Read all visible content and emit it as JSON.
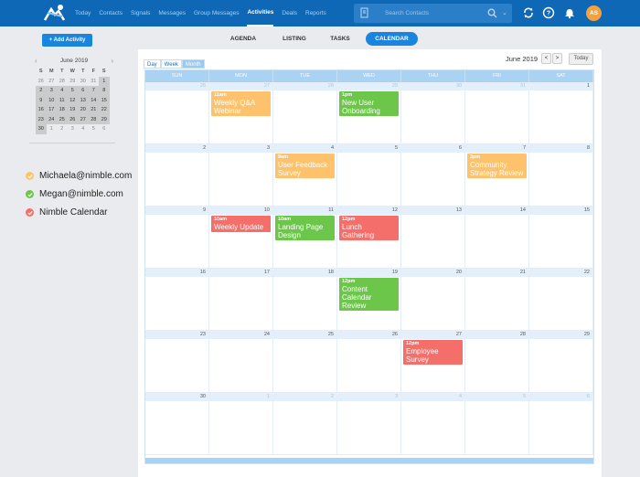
{
  "nav": {
    "items": [
      "Today",
      "Contacts",
      "Signals",
      "Messages",
      "Group Messages",
      "Activities",
      "Deals",
      "Reports"
    ],
    "active": "Activities"
  },
  "search": {
    "placeholder": "Search Contacts"
  },
  "user": {
    "initials": "AS"
  },
  "colors": {
    "topbar": "#0f68b5",
    "accent": "#1a85de",
    "orange": "#fdc26b",
    "green": "#6cc64a",
    "red": "#f46f6a"
  },
  "sidebar": {
    "add_label": "+ Add Activity",
    "mini_cal": {
      "title": "June 2019",
      "dow": [
        "S",
        "M",
        "T",
        "W",
        "T",
        "F",
        "S"
      ],
      "weeks": [
        [
          "26",
          "27",
          "28",
          "29",
          "30",
          "31",
          "1"
        ],
        [
          "2",
          "3",
          "4",
          "5",
          "6",
          "7",
          "8"
        ],
        [
          "9",
          "10",
          "11",
          "12",
          "13",
          "14",
          "15"
        ],
        [
          "16",
          "17",
          "18",
          "19",
          "20",
          "21",
          "22"
        ],
        [
          "23",
          "24",
          "25",
          "26",
          "27",
          "28",
          "29"
        ],
        [
          "30",
          "1",
          "2",
          "3",
          "4",
          "5",
          "6"
        ]
      ]
    },
    "calendars": [
      {
        "label": "Michaela@nimble.com",
        "color": "#fdc26b"
      },
      {
        "label": "Megan@nimble.com",
        "color": "#6cc64a"
      },
      {
        "label": "Nimble Calendar",
        "color": "#f46f6a"
      }
    ]
  },
  "tabs": {
    "agenda": "AGENDA",
    "listing": "LISTING",
    "tasks": "TASKS",
    "calendar": "CALENDAR"
  },
  "calendar": {
    "views": [
      "Day",
      "Week",
      "Month"
    ],
    "active_view": "Month",
    "month_label": "June 2019",
    "prev": "<",
    "next": ">",
    "today": "Today",
    "dow": [
      "SUN",
      "MON",
      "TUE",
      "WED",
      "THU",
      "FRI",
      "SAT"
    ],
    "weeks": [
      [
        {
          "d": "26",
          "out": true
        },
        {
          "d": "27",
          "out": true
        },
        {
          "d": "28",
          "out": true
        },
        {
          "d": "29",
          "out": true
        },
        {
          "d": "30",
          "out": true
        },
        {
          "d": "31",
          "out": true
        },
        {
          "d": "1"
        }
      ],
      [
        {
          "d": "2"
        },
        {
          "d": "3"
        },
        {
          "d": "4"
        },
        {
          "d": "5"
        },
        {
          "d": "6"
        },
        {
          "d": "7"
        },
        {
          "d": "8"
        }
      ],
      [
        {
          "d": "9"
        },
        {
          "d": "10"
        },
        {
          "d": "11"
        },
        {
          "d": "12"
        },
        {
          "d": "13"
        },
        {
          "d": "14"
        },
        {
          "d": "15"
        }
      ],
      [
        {
          "d": "16"
        },
        {
          "d": "17"
        },
        {
          "d": "18"
        },
        {
          "d": "19"
        },
        {
          "d": "20"
        },
        {
          "d": "21"
        },
        {
          "d": "22"
        }
      ],
      [
        {
          "d": "23"
        },
        {
          "d": "24"
        },
        {
          "d": "25"
        },
        {
          "d": "26"
        },
        {
          "d": "27"
        },
        {
          "d": "28"
        },
        {
          "d": "29"
        }
      ],
      [
        {
          "d": "30"
        },
        {
          "d": "1",
          "out": true
        },
        {
          "d": "2",
          "out": true
        },
        {
          "d": "3",
          "out": true
        },
        {
          "d": "4",
          "out": true
        },
        {
          "d": "5",
          "out": true
        },
        {
          "d": "6",
          "out": true
        }
      ]
    ],
    "events": [
      {
        "week": 0,
        "day": 1,
        "time": "11am",
        "title": "Weekly Q&A Webinar",
        "color": "#fdc26b"
      },
      {
        "week": 0,
        "day": 3,
        "time": "1pm",
        "title": "New User Onboarding",
        "color": "#6cc64a"
      },
      {
        "week": 1,
        "day": 2,
        "time": "9am",
        "title": "User Feedback Survey",
        "color": "#fdc26b"
      },
      {
        "week": 1,
        "day": 5,
        "time": "3pm",
        "title": "Community Strategy Review",
        "color": "#fdc26b"
      },
      {
        "week": 2,
        "day": 1,
        "time": "10am",
        "title": "Weekly Update",
        "color": "#f46f6a"
      },
      {
        "week": 2,
        "day": 2,
        "time": "10am",
        "title": "Landing Page Design",
        "color": "#6cc64a"
      },
      {
        "week": 2,
        "day": 3,
        "time": "12pm",
        "title": "Lunch Gathering",
        "color": "#f46f6a"
      },
      {
        "week": 3,
        "day": 3,
        "time": "12pm",
        "title": "Content Calendar Review",
        "color": "#6cc64a"
      },
      {
        "week": 4,
        "day": 4,
        "time": "12pm",
        "title": "Employee Survey",
        "color": "#f46f6a"
      }
    ]
  }
}
